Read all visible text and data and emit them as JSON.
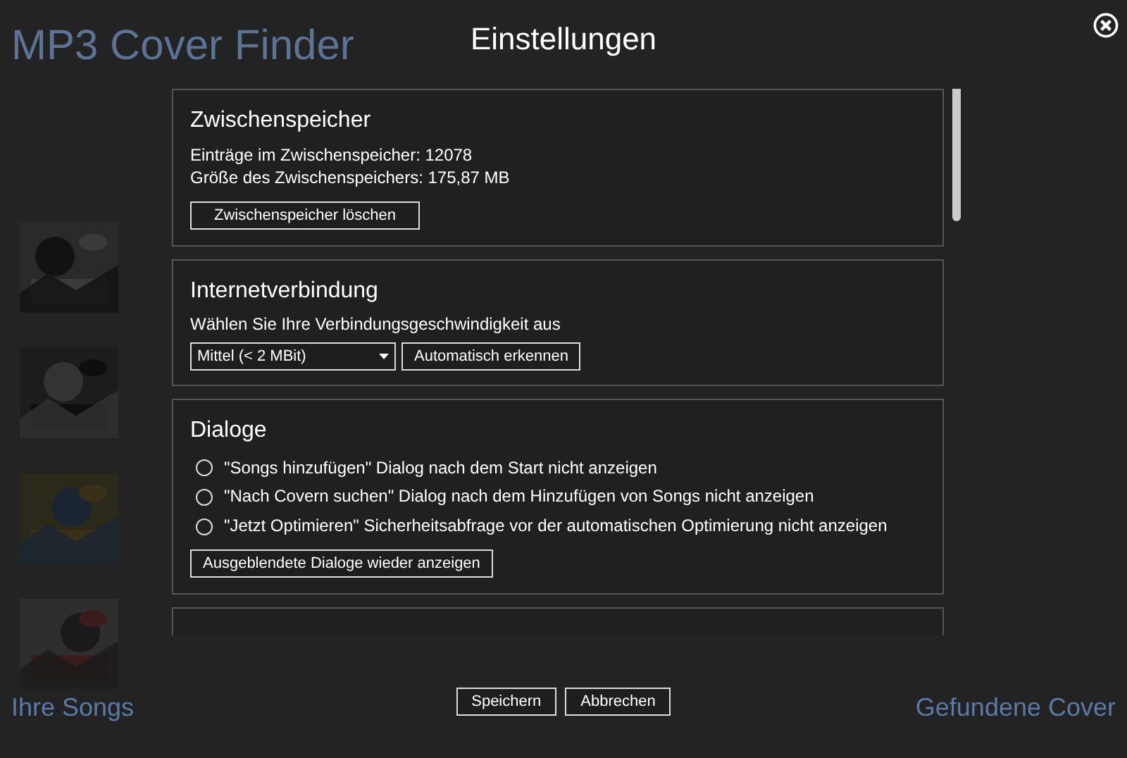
{
  "background_app": {
    "title": "MP3 Cover Finder",
    "left_heading": "Ihre Songs",
    "right_heading": "Gefundene Cover"
  },
  "dialog": {
    "title": "Einstellungen",
    "sections": [
      {
        "kind": "cache",
        "heading": "Zwischenspeicher",
        "lines": [
          "Einträge im Zwischenspeicher: 12078",
          "Größe des Zwischenspeichers: 175,87 MB"
        ],
        "button": "Zwischenspeicher löschen"
      },
      {
        "kind": "connection",
        "heading": "Internetverbindung",
        "description": "Wählen Sie Ihre Verbindungsgeschwindigkeit aus",
        "select": {
          "value": "Mittel (< 2 MBit)"
        },
        "button": "Automatisch erkennen"
      },
      {
        "kind": "dialogs",
        "heading": "Dialoge",
        "options": [
          {
            "label": "\"Songs hinzufügen\" Dialog nach dem Start nicht anzeigen",
            "checked": false
          },
          {
            "label": "\"Nach Covern suchen\" Dialog nach dem Hinzufügen von Songs nicht anzeigen",
            "checked": false
          },
          {
            "label": "\"Jetzt Optimieren\" Sicherheitsabfrage vor der automatischen Optimierung nicht anzeigen",
            "checked": false
          }
        ],
        "button": "Ausgeblendete Dialoge wieder anzeigen"
      },
      {
        "kind": "cut"
      }
    ],
    "buttons": [
      "Speichern",
      "Abbrechen"
    ]
  }
}
